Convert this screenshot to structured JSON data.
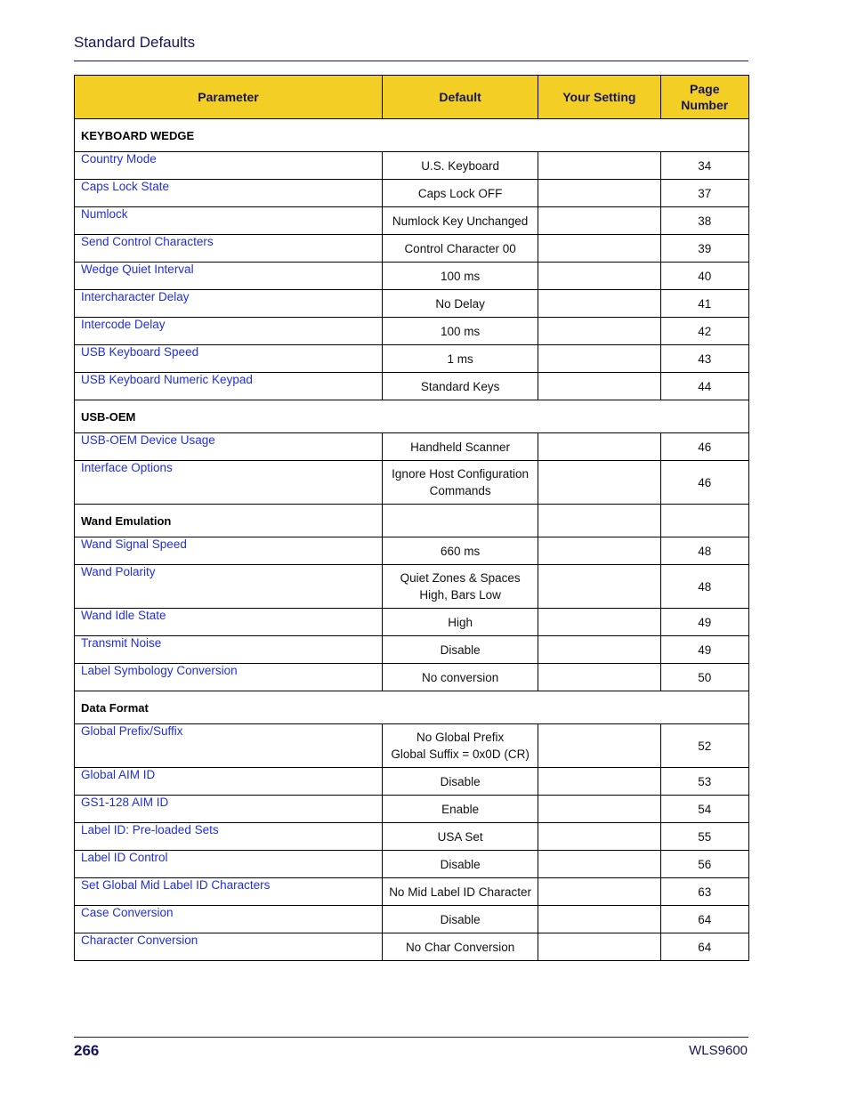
{
  "header": {
    "title": "Standard Defaults"
  },
  "table": {
    "columns": {
      "parameter": "Parameter",
      "default": "Default",
      "your_setting": "Your Setting",
      "page_number": "Page Number"
    },
    "s0": {
      "title": "KEYBOARD WEDGE"
    },
    "r0": {
      "parameter": "Country Mode",
      "default": "U.S. Keyboard",
      "your_setting": "",
      "page": "34"
    },
    "r1": {
      "parameter": "Caps Lock State",
      "default": "Caps Lock OFF",
      "your_setting": "",
      "page": "37"
    },
    "r2": {
      "parameter": "Numlock",
      "default": "Numlock Key Unchanged",
      "your_setting": "",
      "page": "38"
    },
    "r3": {
      "parameter": "Send Control Characters",
      "default": "Control Character 00",
      "your_setting": "",
      "page": "39"
    },
    "r4": {
      "parameter": "Wedge Quiet Interval",
      "default": "100 ms",
      "your_setting": "",
      "page": "40"
    },
    "r5": {
      "parameter": "Intercharacter Delay",
      "default": "No Delay",
      "your_setting": "",
      "page": "41"
    },
    "r6": {
      "parameter": "Intercode Delay",
      "default": "100 ms",
      "your_setting": "",
      "page": "42"
    },
    "r7": {
      "parameter": "USB Keyboard Speed",
      "default": "1 ms",
      "your_setting": "",
      "page": "43"
    },
    "r8": {
      "parameter": "USB Keyboard Numeric Keypad",
      "default": "Standard Keys",
      "your_setting": "",
      "page": "44"
    },
    "s1": {
      "title": "USB-OEM"
    },
    "r9": {
      "parameter": "USB-OEM Device Usage",
      "default": "Handheld Scanner",
      "your_setting": "",
      "page": "46"
    },
    "r10": {
      "parameter": "Interface Options",
      "default": "Ignore Host Configuration Commands",
      "your_setting": "",
      "page": "46"
    },
    "s2": {
      "title": "Wand Emulation"
    },
    "r11": {
      "parameter": "Wand Signal Speed",
      "default": "660 ms",
      "your_setting": "",
      "page": "48"
    },
    "r12": {
      "parameter": "Wand Polarity",
      "default": "Quiet Zones & Spaces High, Bars Low",
      "your_setting": "",
      "page": "48"
    },
    "r13": {
      "parameter": "Wand Idle State",
      "default": "High",
      "your_setting": "",
      "page": "49"
    },
    "r14": {
      "parameter": "Transmit Noise",
      "default": "Disable",
      "your_setting": "",
      "page": "49"
    },
    "r15": {
      "parameter": "Label Symbology Conversion",
      "default": "No conversion",
      "your_setting": "",
      "page": "50"
    },
    "s3": {
      "title": "Data Format"
    },
    "r16": {
      "parameter": "Global Prefix/Suffix",
      "default_line1": "No Global Prefix",
      "default_line2": "Global Suffix = 0x0D (CR)",
      "your_setting": "",
      "page": "52"
    },
    "r17": {
      "parameter": "Global AIM ID",
      "default": "Disable",
      "your_setting": "",
      "page": "53"
    },
    "r18": {
      "parameter": "GS1-128 AIM ID",
      "default": "Enable",
      "your_setting": "",
      "page": "54"
    },
    "r19": {
      "parameter": "Label ID: Pre-loaded Sets",
      "default": "USA Set",
      "your_setting": "",
      "page": "55"
    },
    "r20": {
      "parameter": "Label ID Control",
      "default": "Disable",
      "your_setting": "",
      "page": "56"
    },
    "r21": {
      "parameter": "Set Global Mid Label ID Characters",
      "default": "No Mid Label ID Character",
      "your_setting": "",
      "page": "63"
    },
    "r22": {
      "parameter": "Case Conversion",
      "default": "Disable",
      "your_setting": "",
      "page": "64"
    },
    "r23": {
      "parameter": "Character Conversion",
      "default": "No Char Conversion",
      "your_setting": "",
      "page": "64"
    }
  },
  "footer": {
    "page_number": "266",
    "model": "WLS9600"
  },
  "colors": {
    "header_fill": "#f3cf26",
    "link": "#1f2fe0",
    "navy": "#14145a"
  }
}
